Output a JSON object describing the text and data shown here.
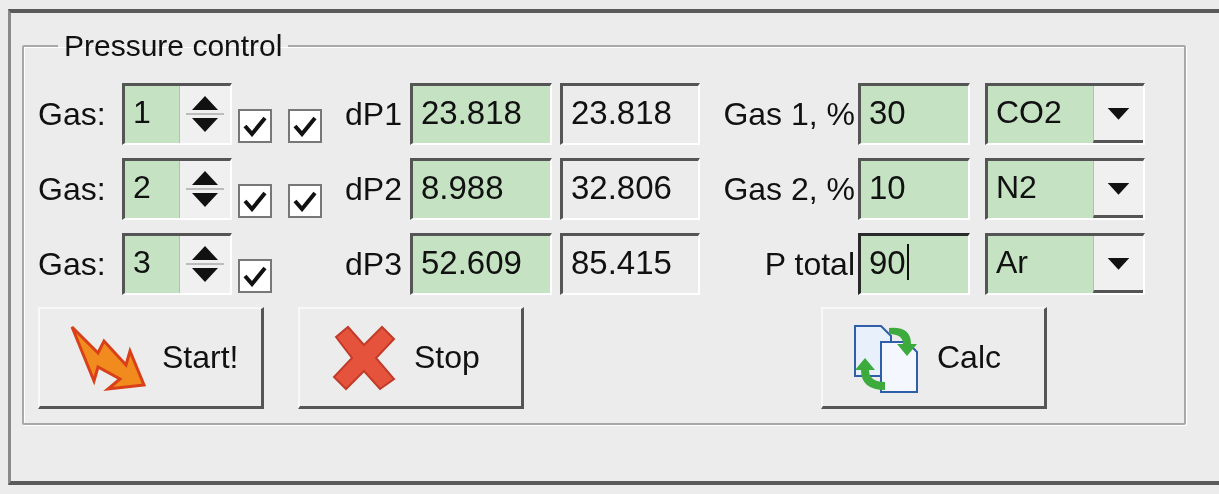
{
  "group": {
    "title": "Pressure control"
  },
  "gas_rows": [
    {
      "label": "Gas:",
      "spinner": "1",
      "checks": [
        {
          "checked": true
        },
        {
          "checked": true
        }
      ],
      "dp_label": "dP1",
      "dp": "23.818",
      "total": "23.818"
    },
    {
      "label": "Gas:",
      "spinner": "2",
      "checks": [
        {
          "checked": true
        },
        {
          "checked": true
        }
      ],
      "dp_label": "dP2",
      "dp": "8.988",
      "total": "32.806"
    },
    {
      "label": "Gas:",
      "spinner": "3",
      "checks": [
        {
          "checked": true
        }
      ],
      "dp_label": "dP3",
      "dp": "52.609",
      "total": "85.415"
    }
  ],
  "mix_rows": [
    {
      "label": "Gas 1, %",
      "value": "30",
      "focused": false,
      "gas": "CO2"
    },
    {
      "label": "Gas 2, %",
      "value": "10",
      "focused": false,
      "gas": "N2"
    },
    {
      "label": "P total",
      "value": "90",
      "focused": true,
      "gas": "Ar"
    }
  ],
  "buttons": [
    {
      "kind": "start",
      "label": "Start!"
    },
    {
      "kind": "stop",
      "label": "Stop"
    },
    {
      "kind": "calc",
      "label": "Calc"
    }
  ]
}
